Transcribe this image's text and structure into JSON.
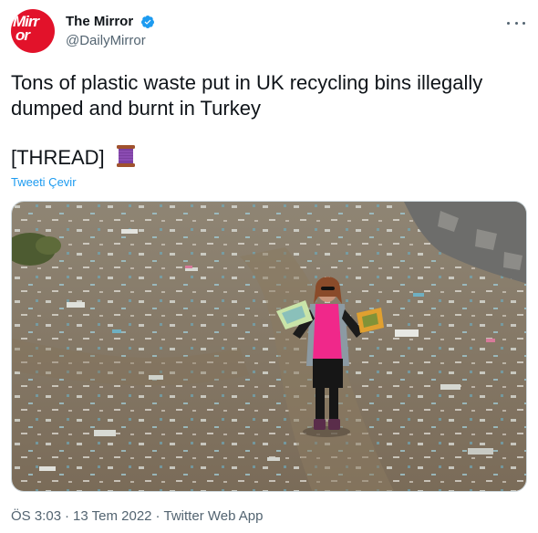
{
  "tweet": {
    "avatar_lines": [
      "Mirr",
      "or"
    ],
    "display_name": "The Mirror",
    "handle": "@DailyMirror",
    "verified_icon": "verified-badge-icon",
    "more_icon": "more-options-icon",
    "text": "Tons of plastic waste put in UK recycling bins illegally dumped and burnt in Turkey",
    "thread_text": "[THREAD]",
    "thread_emoji_icon": "thread-spool-icon",
    "translate_label": "Tweeti Çevir",
    "time": "ÖS 3:03",
    "date": "13 Tem 2022",
    "source": "Twitter Web App",
    "separator": "·"
  },
  "colors": {
    "brand_red": "#e2122a",
    "link_blue": "#1d9bf0",
    "verified_blue": "#1d9bf0",
    "secondary_text": "#536471",
    "primary_text": "#0f1419"
  }
}
